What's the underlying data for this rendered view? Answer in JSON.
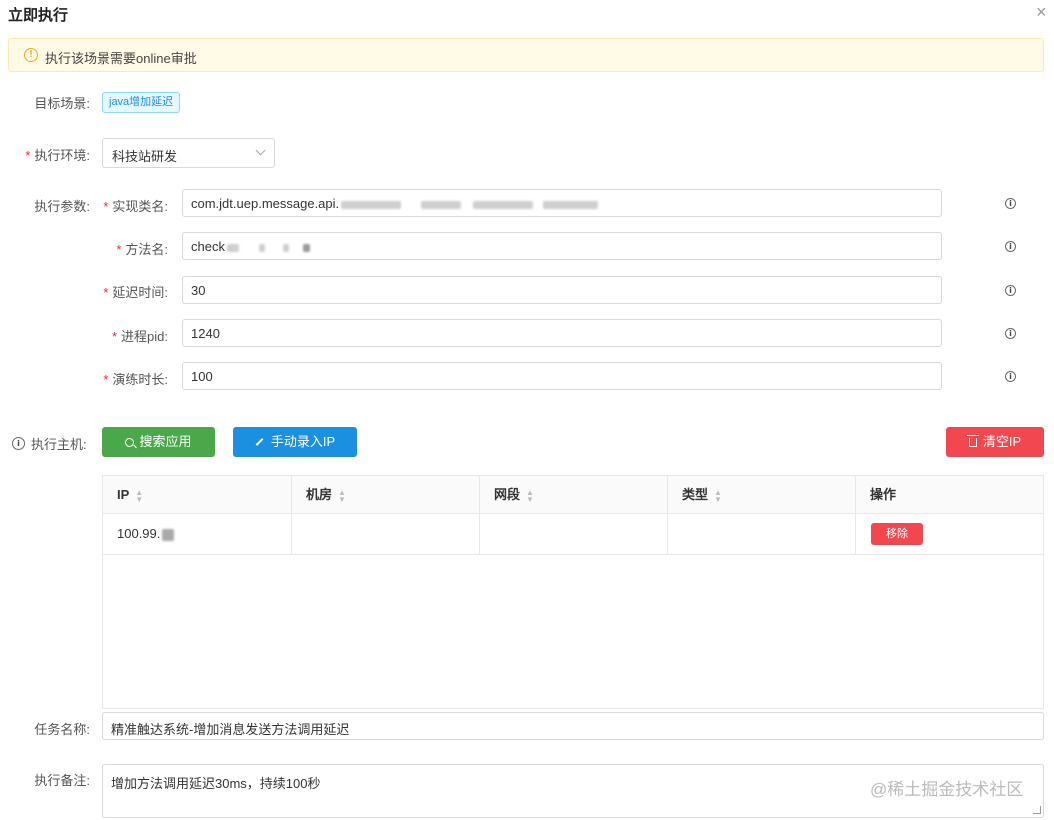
{
  "dialog": {
    "title": "立即执行",
    "close_icon": "×"
  },
  "alert": {
    "text": "执行该场景需要online审批",
    "color": "#f5a623"
  },
  "target": {
    "label": "目标场景:",
    "tag": "java增加延迟"
  },
  "env": {
    "label": "执行环境:",
    "value": "科技站研发"
  },
  "params": {
    "label": "执行参数:",
    "class_name": {
      "label": "实现类名:",
      "value": "com.jdt.uep.message.api."
    },
    "method_name": {
      "label": "方法名:",
      "value": "check"
    },
    "delay": {
      "label": "延迟时间:",
      "value": "30"
    },
    "pid": {
      "label": "进程pid:",
      "value": "1240"
    },
    "duration": {
      "label": "演练时长:",
      "value": "100"
    }
  },
  "host": {
    "label": "执行主机:",
    "search_button": "搜索应用",
    "manual_button": "手动录入IP",
    "clear_button": "清空IP"
  },
  "table": {
    "columns": [
      "IP",
      "机房",
      "网段",
      "类型",
      "操作"
    ],
    "rows": [
      {
        "ip": "100.99.",
        "room": "",
        "segment": "",
        "type": "",
        "action": "移除"
      }
    ]
  },
  "task": {
    "label": "任务名称:",
    "value": "精准触达系统-增加消息发送方法调用延迟"
  },
  "remark": {
    "label": "执行备注:",
    "value": "增加方法调用延迟30ms，持续100秒"
  },
  "watermark": "@稀土掘金技术社区",
  "colors": {
    "green": "#4aa84a",
    "blue": "#1b8fe0",
    "red": "#f2474e",
    "required": "#f5222d"
  }
}
